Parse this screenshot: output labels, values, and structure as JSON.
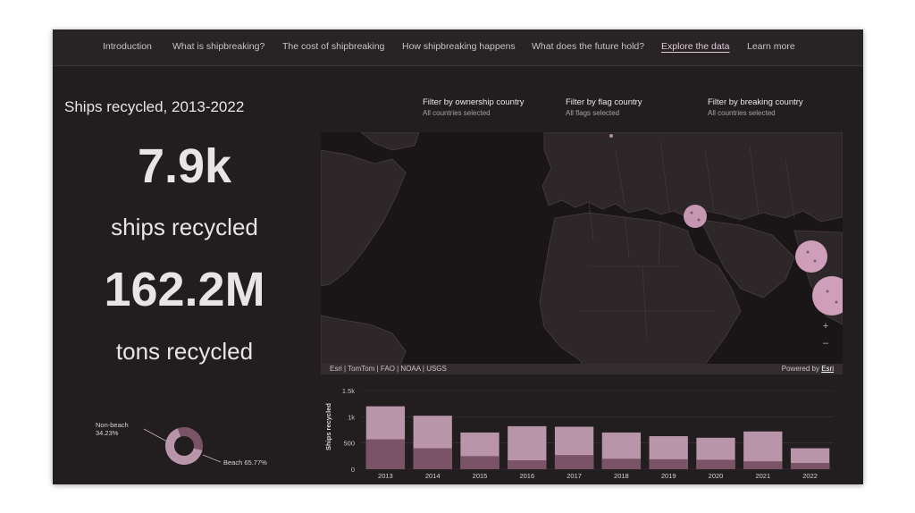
{
  "nav": {
    "items": [
      {
        "label": "Introduction",
        "active": false
      },
      {
        "label": "What is shipbreaking?",
        "active": false
      },
      {
        "label": "The cost of shipbreaking",
        "active": false
      },
      {
        "label": "How shipbreaking happens",
        "active": false
      },
      {
        "label": "What does the future hold?",
        "active": false
      },
      {
        "label": "Explore the data",
        "active": true
      },
      {
        "label": "Learn more",
        "active": false
      }
    ]
  },
  "summary": {
    "title": "Ships recycled, 2013-2022",
    "ships_value": "7.9k",
    "ships_label": "ships recycled",
    "tons_value": "162.2M",
    "tons_label": "tons recycled"
  },
  "filters": [
    {
      "title": "Filter by ownership country",
      "status": "All countries selected"
    },
    {
      "title": "Filter by flag country",
      "status": "All flags selected"
    },
    {
      "title": "Filter by breaking country",
      "status": "All countries selected"
    }
  ],
  "map": {
    "attribution": "Esri | TomTom | FAO | NOAA | USGS",
    "powered_prefix": "Powered by ",
    "powered_link": "Esri",
    "zoom_in": "+",
    "zoom_out": "–"
  },
  "colors": {
    "background": "#221d1f",
    "bar_total": "#b995a9",
    "bar_beach": "#7a5466",
    "accent": "#e0c9d6"
  },
  "chart_data": [
    {
      "type": "pie",
      "variant": "donut",
      "labels": [
        "Non-beach",
        "Beach"
      ],
      "values": [
        34.23,
        65.77
      ],
      "label_texts": [
        "Non-beach",
        "34.23%",
        "Beach 65.77%"
      ]
    },
    {
      "type": "bar",
      "categories": [
        "2013",
        "2014",
        "2015",
        "2016",
        "2017",
        "2018",
        "2019",
        "2020",
        "2021",
        "2022"
      ],
      "series": [
        {
          "values": [
            1200,
            1020,
            700,
            820,
            810,
            700,
            630,
            600,
            720,
            400
          ]
        },
        {
          "values": [
            570,
            400,
            250,
            170,
            270,
            200,
            190,
            180,
            150,
            120
          ]
        }
      ],
      "ylabel": "Ships recycled",
      "yticks": [
        "0",
        "500",
        "1k",
        "1.5k"
      ],
      "ylim": [
        0,
        1500
      ]
    }
  ]
}
